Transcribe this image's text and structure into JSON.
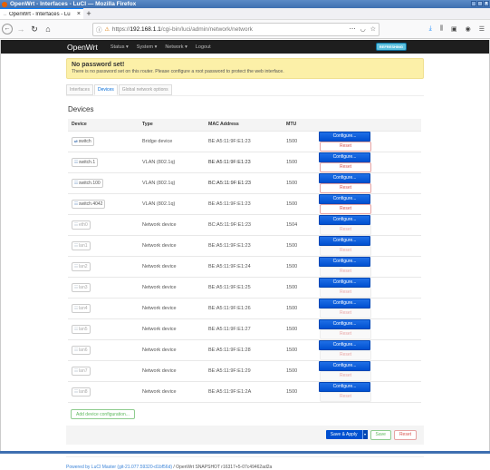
{
  "window": {
    "title": "OpenWrt - Interfaces - LuCI — Mozilla Firefox"
  },
  "browser": {
    "tab_title": "OpenWrt - Interfaces - Lu",
    "url_prefix": "https://",
    "url_host": "192.168.1.1",
    "url_path": "/cgi-bin/luci/admin/network/network"
  },
  "header": {
    "brand": "OpenWrt",
    "menu": [
      "Status ▾",
      "System ▾",
      "Network ▾",
      "Logout"
    ],
    "badge": "REFRESHING"
  },
  "alert": {
    "title": "No password set!",
    "message": "There is no password set on this router. Please configure a root password to protect the web interface."
  },
  "tabs": [
    {
      "label": "Interfaces",
      "active": false
    },
    {
      "label": "Devices",
      "active": true
    },
    {
      "label": "Global network options",
      "active": false
    }
  ],
  "section": {
    "title": "Devices",
    "columns": [
      "Device",
      "Type",
      "MAC Address",
      "MTU"
    ],
    "configure_label": "Configure...",
    "reset_label": "Reset",
    "rows": [
      {
        "device": "switch",
        "type": "Bridge device",
        "mac": "BE:A5:11:9F:E1:23",
        "mtu": "1500",
        "configured": true
      },
      {
        "device": "switch.1",
        "type": "VLAN (802.1q)",
        "mac": "BE:A5:11:9F:E1:23",
        "mtu": "1500",
        "configured": true
      },
      {
        "device": "switch.100",
        "type": "VLAN (802.1q)",
        "mac": "BC:A5:11:9F:E1:23",
        "mtu": "1500",
        "configured": true
      },
      {
        "device": "switch.4042",
        "type": "VLAN (802.1q)",
        "mac": "BE:A5:11:9F:E1:23",
        "mtu": "1500",
        "configured": true
      },
      {
        "device": "eth0",
        "type": "Network device",
        "mac": "BC:A5:11:9F:E1:23",
        "mtu": "1504",
        "configured": false
      },
      {
        "device": "lan1",
        "type": "Network device",
        "mac": "BE:A5:11:9F:E1:23",
        "mtu": "1500",
        "configured": false
      },
      {
        "device": "lan2",
        "type": "Network device",
        "mac": "BE:A5:11:9F:E1:24",
        "mtu": "1500",
        "configured": false
      },
      {
        "device": "lan3",
        "type": "Network device",
        "mac": "BE:A5:11:9F:E1:25",
        "mtu": "1500",
        "configured": false
      },
      {
        "device": "lan4",
        "type": "Network device",
        "mac": "BE:A5:11:9F:E1:26",
        "mtu": "1500",
        "configured": false
      },
      {
        "device": "lan5",
        "type": "Network device",
        "mac": "BE:A5:11:9F:E1:27",
        "mtu": "1500",
        "configured": false
      },
      {
        "device": "lan6",
        "type": "Network device",
        "mac": "BE:A5:11:9F:E1:28",
        "mtu": "1500",
        "configured": false
      },
      {
        "device": "lan7",
        "type": "Network device",
        "mac": "BE:A5:11:9F:E1:29",
        "mtu": "1500",
        "configured": false
      },
      {
        "device": "lan8",
        "type": "Network device",
        "mac": "BE:A5:11:9F:E1:2A",
        "mtu": "1500",
        "configured": false
      }
    ],
    "add_label": "Add device configuration..."
  },
  "actions": {
    "save_apply": "Save & Apply",
    "dropdown": "▾",
    "save": "Save",
    "reset": "Reset"
  },
  "footer": {
    "link": "Powered by LuCI Master (git-21.077.59320-d1bf56d)",
    "text": " / OpenWrt SNAPSHOT r16317+5-07c49462ad2a"
  }
}
